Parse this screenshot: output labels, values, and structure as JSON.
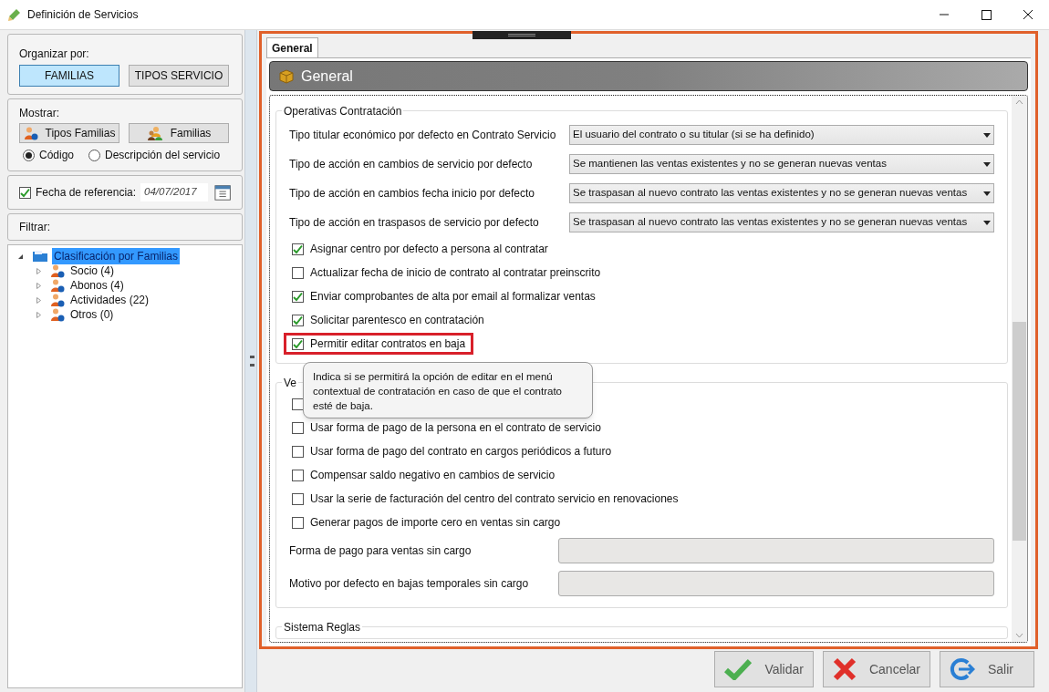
{
  "window": {
    "title": "Definición de Servicios"
  },
  "left_panel": {
    "organize": {
      "label": "Organizar por:",
      "buttons": [
        {
          "label": "FAMILIAS",
          "selected": true
        },
        {
          "label": "TIPOS SERVICIO",
          "selected": false
        }
      ]
    },
    "show": {
      "label": "Mostrar:",
      "buttons": [
        {
          "label": "Tipos Familias"
        },
        {
          "label": "Familias"
        }
      ],
      "radios": [
        {
          "label": "Código",
          "selected": true
        },
        {
          "label": "Descripción del servicio",
          "selected": false
        }
      ]
    },
    "reference_date": {
      "label": "Fecha de referencia:",
      "checked": true,
      "value": "04/07/2017"
    },
    "filter": {
      "label": "Filtrar:"
    },
    "tree": [
      {
        "label": "Clasificación por Familias",
        "expanded": true,
        "selected": true,
        "children": [
          {
            "label": "Socio (4)",
            "expanded": false,
            "selected": false
          },
          {
            "label": "Abonos (4)",
            "expanded": false,
            "selected": false
          },
          {
            "label": "Actividades (22)",
            "expanded": false,
            "selected": false
          },
          {
            "label": "Otros (0)",
            "expanded": false,
            "selected": false
          }
        ]
      }
    ]
  },
  "right_panel": {
    "tabs": [
      {
        "label": "General",
        "selected": true
      }
    ],
    "header": {
      "title": "General"
    },
    "groups": [
      {
        "title": "Operativas Contratación",
        "items": [
          {
            "kind": "select",
            "label": "Tipo titular económico por defecto en Contrato Servicio",
            "value": "El usuario del contrato o su titular (si se ha definido)"
          },
          {
            "kind": "select",
            "label": "Tipo de acción en cambios de servicio por defecto",
            "value": "Se mantienen las ventas existentes y no se generan nuevas ventas"
          },
          {
            "kind": "select",
            "label": "Tipo de acción en cambios fecha inicio por defecto",
            "value": "Se traspasan al nuevo contrato las ventas existentes y no se generan nuevas ventas"
          },
          {
            "kind": "select",
            "label": "Tipo de acción en traspasos de servicio por defecto",
            "value": "Se traspasan al nuevo contrato las ventas existentes y no se generan nuevas ventas"
          },
          {
            "kind": "checkbox",
            "label": "Asignar centro por defecto a persona al contratar",
            "checked": true,
            "highlighted": false
          },
          {
            "kind": "checkbox",
            "label": "Actualizar fecha de inicio de contrato al contratar preinscrito",
            "checked": false,
            "highlighted": false
          },
          {
            "kind": "checkbox",
            "label": "Enviar comprobantes de alta por email al formalizar ventas",
            "checked": true,
            "highlighted": false
          },
          {
            "kind": "checkbox",
            "label": "Solicitar parentesco en contratación",
            "checked": true,
            "highlighted": false
          },
          {
            "kind": "checkbox",
            "label": "Permitir editar contratos en baja",
            "checked": true,
            "highlighted": true
          }
        ]
      },
      {
        "title": "Ve",
        "items": [
          {
            "kind": "checkbox",
            "checked": false,
            "highlighted": false
          },
          {
            "kind": "checkbox",
            "label": "Usar forma de pago de la persona en el contrato de servicio",
            "checked": false,
            "highlighted": false
          },
          {
            "kind": "checkbox",
            "label": "Usar forma de pago del contrato en cargos periódicos a futuro",
            "checked": false,
            "highlighted": false
          },
          {
            "kind": "checkbox",
            "label": "Compensar saldo negativo en cambios de servicio",
            "checked": false,
            "highlighted": false
          },
          {
            "kind": "checkbox",
            "label": "Usar la serie de facturación del centro del contrato servicio en renovaciones",
            "checked": false,
            "highlighted": false
          },
          {
            "kind": "checkbox",
            "label": "Generar pagos de importe cero en ventas sin cargo",
            "checked": false,
            "highlighted": false
          },
          {
            "kind": "field",
            "label": "Forma de pago para ventas sin cargo"
          },
          {
            "kind": "field",
            "label": "Motivo por defecto en bajas temporales sin cargo"
          }
        ]
      },
      {
        "title": "Sistema Reglas"
      }
    ],
    "tooltip": {
      "text": "Indica si se permitirá la opción de editar en el menú contextual de contratación en caso de que el contrato esté de baja."
    }
  },
  "buttons": [
    {
      "label": "Validar"
    },
    {
      "label": "Cancelar"
    },
    {
      "label": "Salir"
    }
  ]
}
